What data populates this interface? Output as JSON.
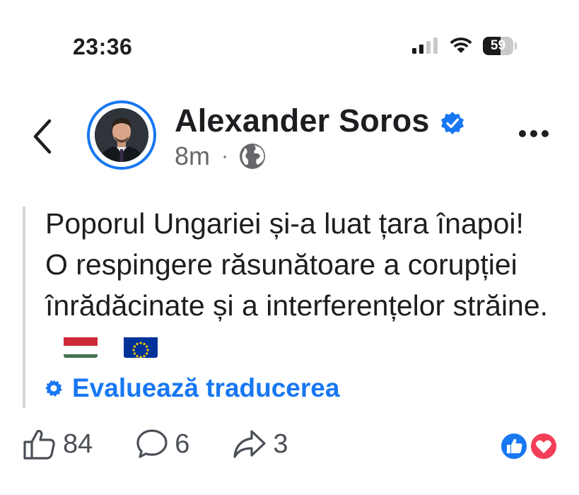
{
  "status_bar": {
    "time": "23:36",
    "battery": "59",
    "battery_level": 0.59,
    "icons": [
      "cellular-signal-icon",
      "wifi-icon",
      "battery-icon"
    ]
  },
  "header": {
    "back_icon": "chevron-left-icon",
    "author_name": "Alexander Soros",
    "verified_icon": "verified-badge-icon",
    "time_ago": "8m",
    "separator": "·",
    "privacy_icon": "globe-icon",
    "more_icon": "more-horizontal-icon"
  },
  "post": {
    "text": "Poporul Ungariei și-a luat țara înapoi! O respingere răsunătoare a corupției înrădăcinate și a interferențelor străine.",
    "emojis": [
      "flag-hungary",
      "flag-eu"
    ],
    "translate_label": "Evaluează traducerea",
    "translate_icon": "gear-icon"
  },
  "actions": {
    "likes": "84",
    "comments": "6",
    "shares": "3",
    "reaction_icons": [
      "like-reaction-icon",
      "love-reaction-icon"
    ]
  },
  "colors": {
    "accent": "#1877f2",
    "love": "#f33e58",
    "text": "#1c1e21",
    "muted": "#65676b"
  }
}
